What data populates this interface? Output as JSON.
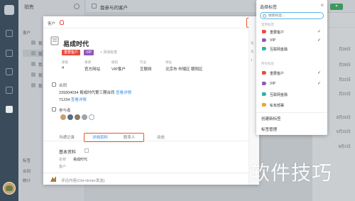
{
  "sidebar": {
    "title": "销售",
    "groups": {
      "customers": "客户",
      "tags": "标签",
      "contracts": "合同",
      "stats": "统计"
    },
    "items": [
      "我",
      "我",
      "我",
      "我",
      "我"
    ]
  },
  "header": {
    "title": "我参与的客户"
  },
  "background_list": {
    "dates": [
      "月28日",
      "月28日",
      "月22日",
      "月22日",
      "8月16日",
      "6月15日",
      "8月1日"
    ]
  },
  "modal": {
    "type_label": "客户",
    "customer_name": "易成时代",
    "tags": [
      {
        "label": "重要客户",
        "color": "#e84d3d"
      },
      {
        "label": "VIP",
        "color": "#8e5ab5"
      }
    ],
    "add_tag_label": "+ 添加标签",
    "fields": [
      {
        "label": "星级",
        "value": "4"
      },
      {
        "label": "来源",
        "value": "官方网站"
      },
      {
        "label": "级别",
        "value": "VIP客户"
      },
      {
        "label": "行业",
        "value": "互联网"
      },
      {
        "label": "地址",
        "value": "北京市 市辖区 朝阳区"
      }
    ],
    "contracts": {
      "title": "合同",
      "lines": [
        {
          "text": "239304034 易成时代第三期合同",
          "link": "查看详情"
        },
        {
          "text": "71234",
          "link": "查看详情"
        }
      ]
    },
    "participants_title": "参与者",
    "tabs": [
      "沟通记录",
      "详细资料",
      "联系人",
      "动态"
    ],
    "basic_info": {
      "title": "基本资料",
      "rows": [
        {
          "label": "名称",
          "value": "易成时代"
        },
        {
          "label": "客户",
          "value": ""
        }
      ]
    },
    "comment_placeholder": "评论内容(Ctrl+Enter发送)",
    "right_edge_texts": [
      "北",
      "负",
      "1"
    ]
  },
  "tag_panel": {
    "title": "选择标签",
    "close": "×",
    "search_placeholder": "搜索标签...",
    "group_common": "常用标签",
    "group_all": "所有标签",
    "common": [
      {
        "label": "重要客户",
        "color": "#e84d3d",
        "check": "✓"
      },
      {
        "label": "VIP",
        "color": "#8e5ab5",
        "check": "✓"
      },
      {
        "label": "互联网金融",
        "color": "#2bb3a8",
        "check": ""
      }
    ],
    "all": [
      {
        "label": "重要客户",
        "color": "#e84d3d",
        "check": "✓"
      },
      {
        "label": "VIP",
        "color": "#8e5ab5",
        "check": "✓"
      },
      {
        "label": "互联网金融",
        "color": "#2bb3a8",
        "check": ""
      },
      {
        "label": "私有部署",
        "color": "#f0a030",
        "check": ""
      }
    ],
    "create_label": "创建新标签",
    "manage_label": "标签管理"
  },
  "watermark": "软件技巧"
}
